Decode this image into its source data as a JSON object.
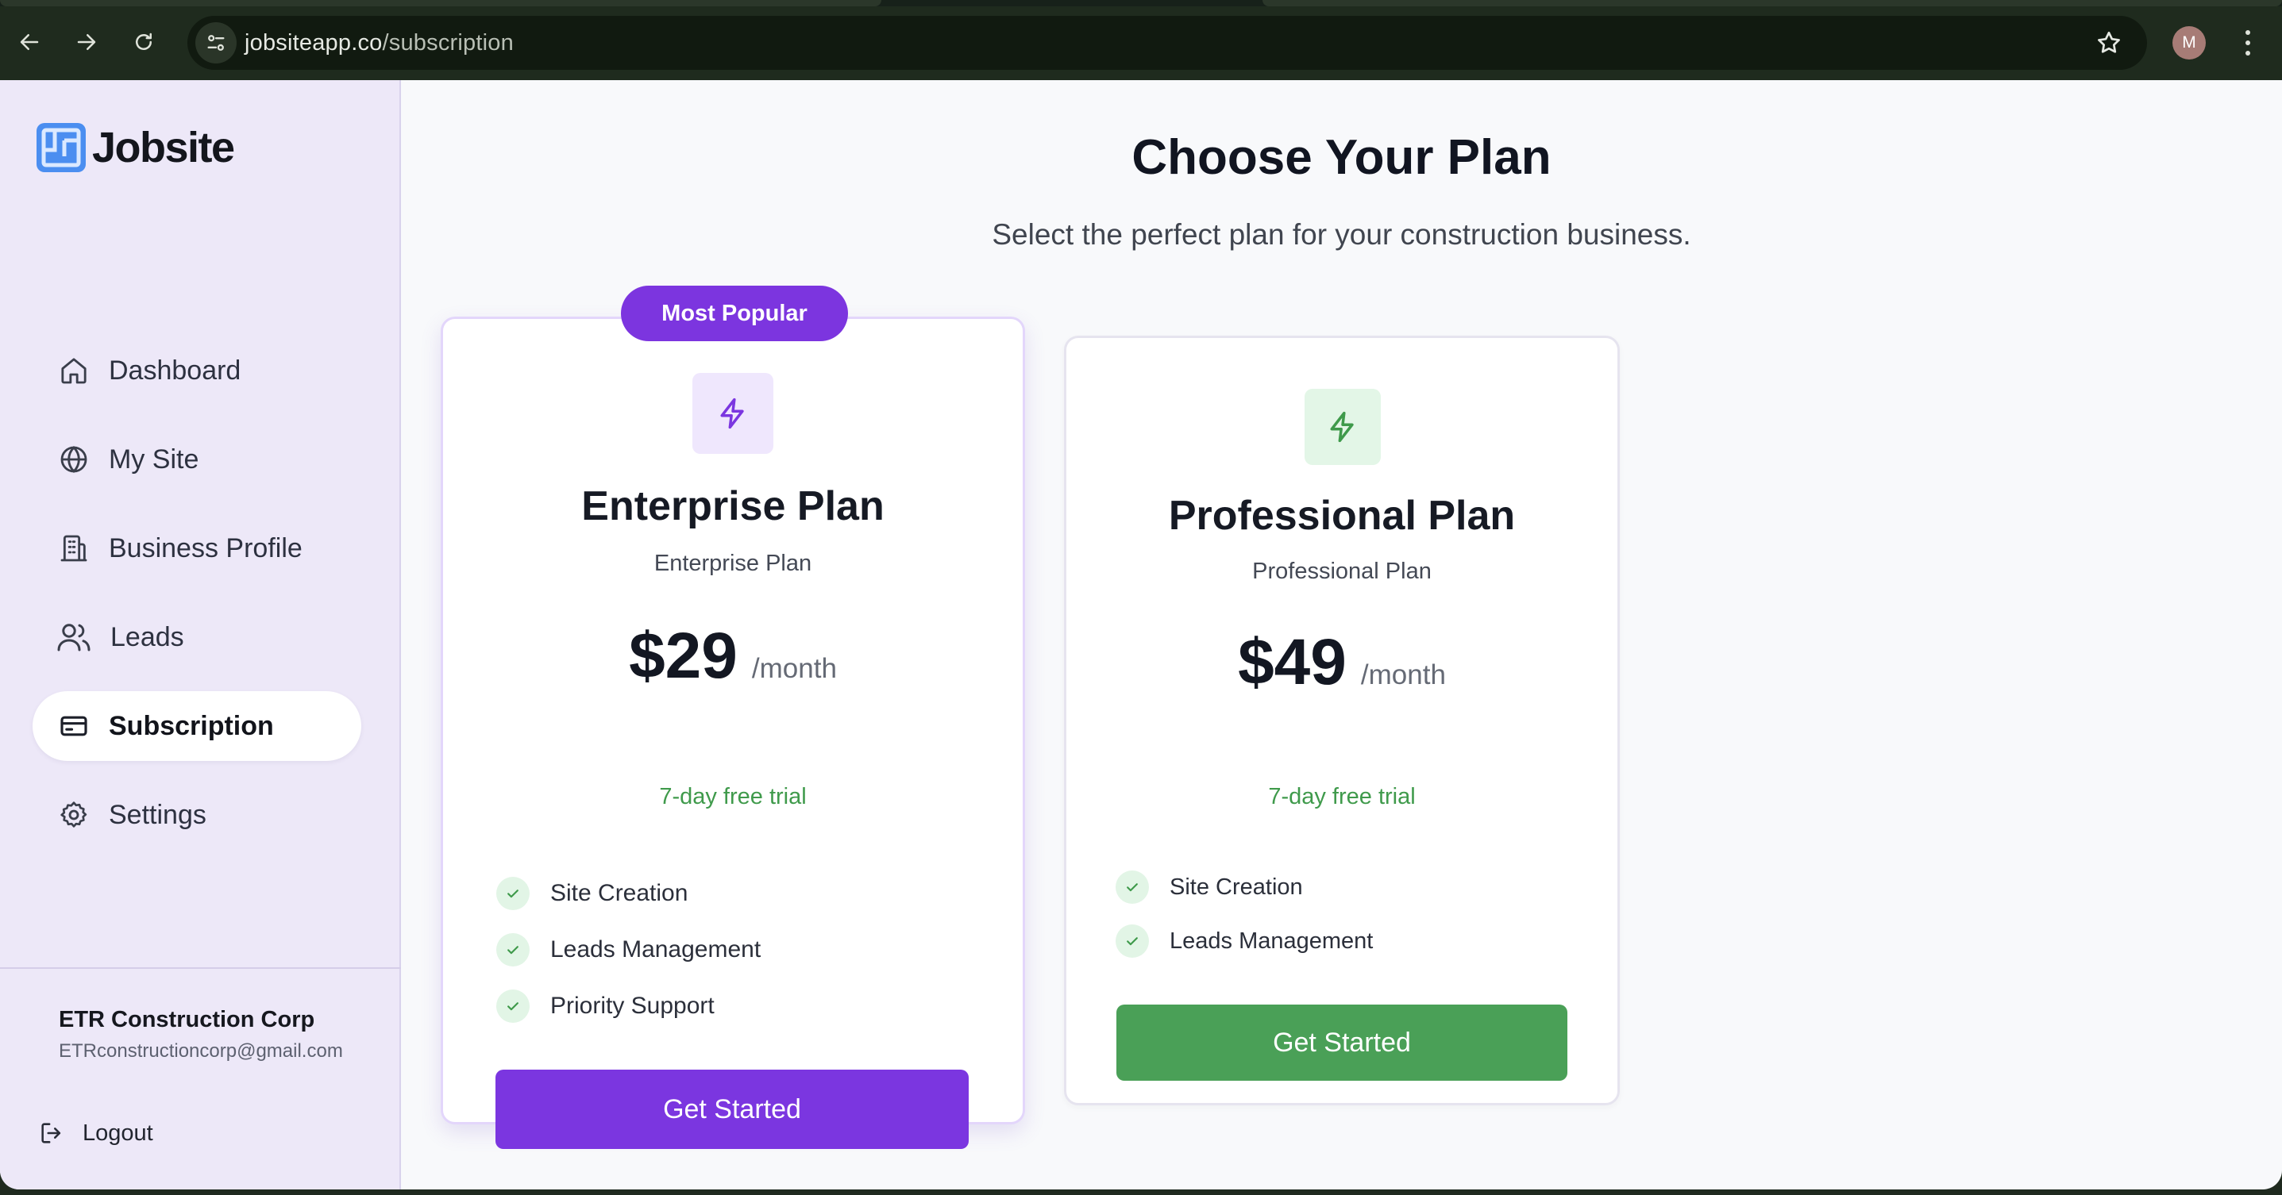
{
  "browser": {
    "url_host": "jobsiteapp.co",
    "url_path": "/subscription",
    "profile_initial": "M"
  },
  "sidebar": {
    "brand": "Jobsite",
    "items": [
      {
        "label": "Dashboard",
        "icon": "home-icon",
        "active": false
      },
      {
        "label": "My Site",
        "icon": "globe-icon",
        "active": false
      },
      {
        "label": "Business Profile",
        "icon": "building-icon",
        "active": false
      },
      {
        "label": "Leads",
        "icon": "users-icon",
        "active": false
      },
      {
        "label": "Subscription",
        "icon": "credit-card-icon",
        "active": true
      },
      {
        "label": "Settings",
        "icon": "gear-icon",
        "active": false
      }
    ],
    "account": {
      "name": "ETR Construction Corp",
      "email": "ETRconstructioncorp@gmail.com"
    },
    "logout_label": "Logout"
  },
  "main": {
    "title": "Choose Your Plan",
    "subtitle": "Select the perfect plan for your construction business."
  },
  "plans": [
    {
      "badge": "Most Popular",
      "name": "Enterprise Plan",
      "description": "Enterprise Plan",
      "price": "$29",
      "period": "/month",
      "trial": "7-day free trial",
      "features": [
        "Site Creation",
        "Leads Management",
        "Priority Support"
      ],
      "cta": "Get Started",
      "accent": "#7b36e0"
    },
    {
      "name": "Professional Plan",
      "description": "Professional Plan",
      "price": "$49",
      "period": "/month",
      "trial": "7-day free trial",
      "features": [
        "Site Creation",
        "Leads Management"
      ],
      "cta": "Get Started",
      "accent": "#4aa057"
    }
  ],
  "colors": {
    "sidebar_bg": "#ede8f8",
    "enterprise_accent": "#7b36e0",
    "professional_accent": "#4aa057",
    "trial_text": "#3f9a4b"
  }
}
